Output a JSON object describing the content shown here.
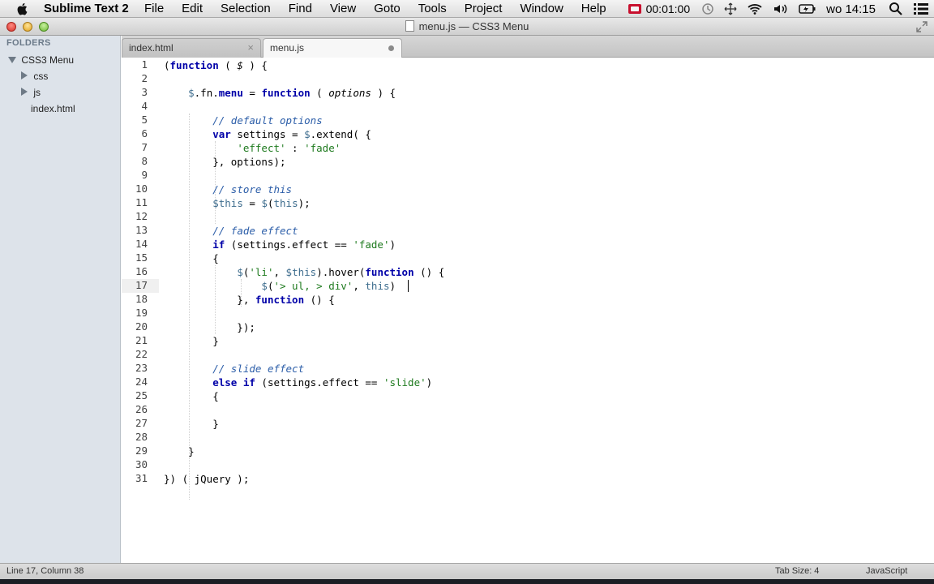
{
  "menubar": {
    "app_name": "Sublime Text 2",
    "items": [
      "File",
      "Edit",
      "Selection",
      "Find",
      "View",
      "Goto",
      "Tools",
      "Project",
      "Window",
      "Help"
    ],
    "timer": "00:01:00",
    "clock": "wo 14:15"
  },
  "window": {
    "title": "menu.js — CSS3 Menu"
  },
  "sidebar": {
    "header": "FOLDERS",
    "root": "CSS3 Menu",
    "folders": [
      "css",
      "js"
    ],
    "files": [
      "index.html"
    ]
  },
  "tabs": [
    {
      "label": "index.html",
      "state": "close"
    },
    {
      "label": "menu.js",
      "state": "dirty"
    }
  ],
  "editor": {
    "line_numbers": [
      "1",
      "2",
      "3",
      "4",
      "5",
      "6",
      "7",
      "8",
      "9",
      "10",
      "11",
      "12",
      "13",
      "14",
      "15",
      "16",
      "17",
      "18",
      "19",
      "20",
      "21",
      "22",
      "23",
      "24",
      "25",
      "26",
      "27",
      "28",
      "29",
      "30",
      "31"
    ],
    "current_line": 17
  },
  "statusbar": {
    "position": "Line 17, Column 38",
    "tab_size": "Tab Size: 4",
    "syntax": "JavaScript"
  },
  "colors": {
    "keyword": "#0000a8",
    "comment": "#2b5da8",
    "string": "#1e7a1e",
    "variable": "#3e6d8e"
  }
}
